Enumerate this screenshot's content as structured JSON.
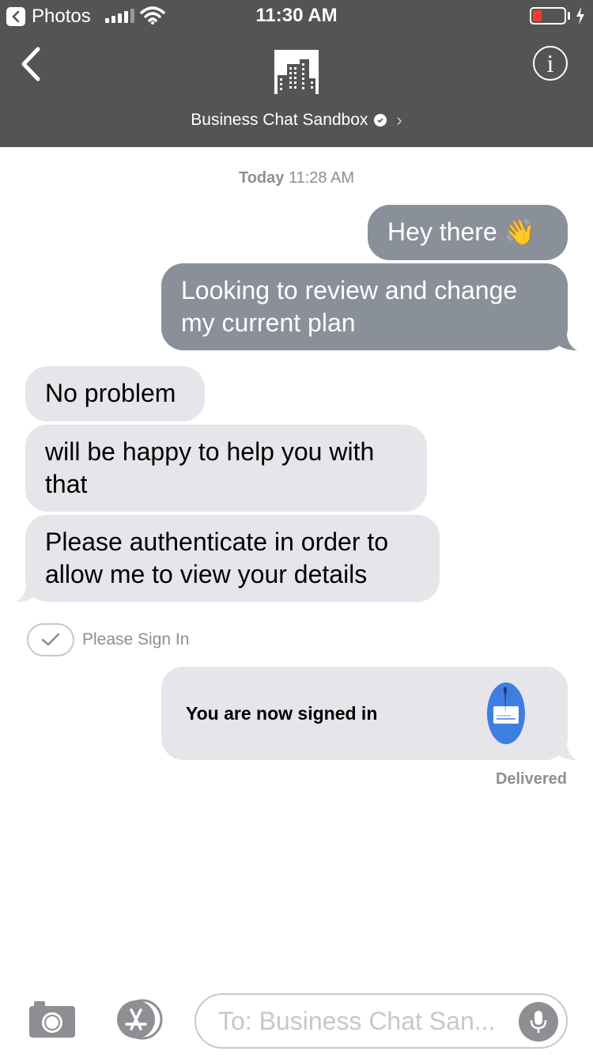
{
  "status_bar": {
    "back_app_label": "Photos",
    "time": "11:30 AM"
  },
  "header": {
    "chat_title": "Business Chat Sandbox"
  },
  "conversation": {
    "timestamp_day": "Today",
    "timestamp_time": "11:28 AM",
    "messages": [
      {
        "direction": "sent",
        "text": "Hey there 👋"
      },
      {
        "direction": "sent",
        "text": "Looking to review and change my current plan"
      },
      {
        "direction": "received",
        "text": "No problem"
      },
      {
        "direction": "received",
        "text": "will be happy to help you with that"
      },
      {
        "direction": "received",
        "text": "Please authenticate in order to allow me to view your details"
      }
    ],
    "sign_in_prompt": "Please Sign In",
    "signed_in_card": "You are now signed in",
    "delivery_status": "Delivered"
  },
  "composer": {
    "placeholder": "To: Business Chat San..."
  },
  "colors": {
    "header_bg": "#545454",
    "sent_bubble": "#8a9099",
    "received_bubble": "#e5e5ea",
    "battery_low": "#ff3b30",
    "signed_in_icon": "#3d7ee0"
  }
}
